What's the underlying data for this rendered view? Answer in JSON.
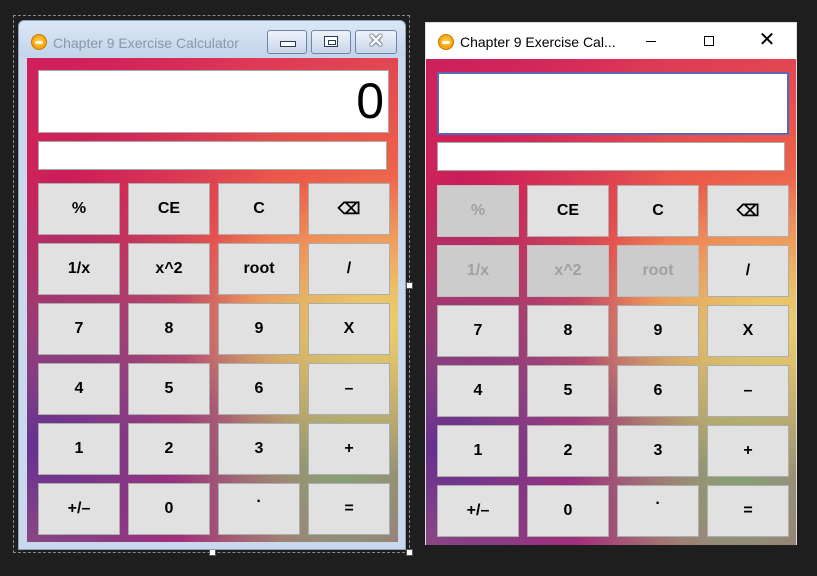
{
  "window_design": {
    "title": "Chapter 9 Exercise Calculator",
    "display_value": "0",
    "history_value": "",
    "controls": {
      "minimize": "",
      "maximize": "",
      "close": "✕"
    }
  },
  "window_runtime": {
    "title": "Chapter 9 Exercise Cal...",
    "display_value": "",
    "history_value": "",
    "controls": {
      "minimize": "",
      "maximize": "",
      "close": "✕"
    }
  },
  "keypad": [
    [
      "%",
      "CE",
      "C",
      "⌫"
    ],
    [
      "1/x",
      "x^2",
      "root",
      "/"
    ],
    [
      "7",
      "8",
      "9",
      "X"
    ],
    [
      "4",
      "5",
      "6",
      "–"
    ],
    [
      "1",
      "2",
      "3",
      "+"
    ],
    [
      "+/–",
      "0",
      "·",
      "="
    ]
  ],
  "runtime_disabled_keys": [
    "%",
    "1/x",
    "x^2",
    "root"
  ],
  "colors": {
    "button_face": "#e1e1e1",
    "button_disabled": "#cccccc",
    "display_focus_border": "#5a66b8"
  }
}
